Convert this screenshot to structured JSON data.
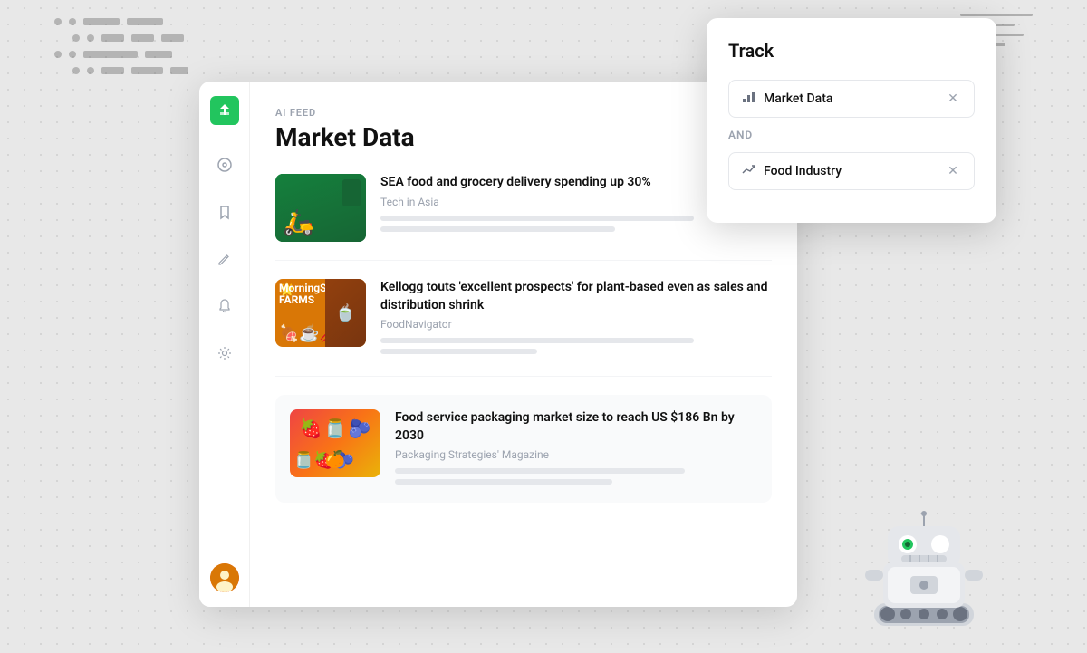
{
  "background": {
    "dots": true
  },
  "sidebar": {
    "logo_letter": "✦",
    "icons": [
      "◎",
      "🔖",
      "✏",
      "🔔",
      "👤"
    ]
  },
  "header": {
    "feed_label": "AI FEED",
    "page_title": "Market Data"
  },
  "news_items": [
    {
      "id": 1,
      "title": "SEA food and grocery delivery spending up 30%",
      "source": "Tech in Asia",
      "highlighted": false,
      "thumb_class": "thumb-1"
    },
    {
      "id": 2,
      "title": "Kellogg touts 'excellent prospects' for plant-based even as sales and distribution shrink",
      "source": "FoodNavigator",
      "highlighted": false,
      "thumb_class": "thumb-2"
    },
    {
      "id": 3,
      "title": "Food service packaging market size to reach US $186 Bn by 2030",
      "source": "Packaging Strategies' Magazine",
      "highlighted": true,
      "thumb_class": "thumb-3"
    }
  ],
  "track_panel": {
    "title": "Track",
    "tag1": {
      "label": "Market Data",
      "icon": "📊"
    },
    "connector": "AND",
    "tag2": {
      "label": "Food Industry",
      "icon": "📈"
    }
  }
}
